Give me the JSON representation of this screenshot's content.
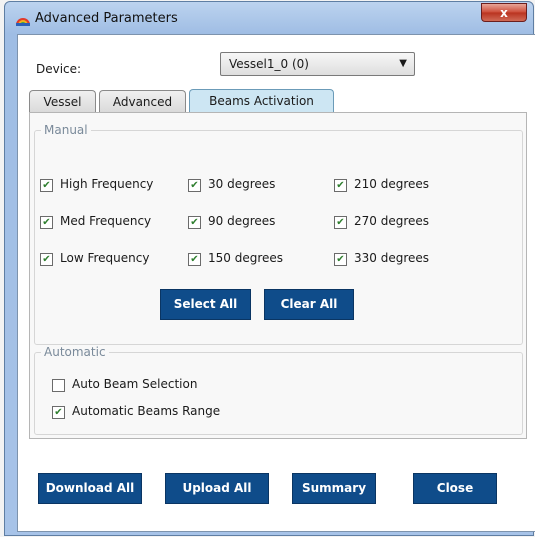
{
  "window": {
    "title": "Advanced Parameters",
    "close_glyph": "x"
  },
  "device": {
    "label": "Device:",
    "selected": "Vessel1_0 (0)"
  },
  "tabs": [
    {
      "label": "Vessel",
      "active": false
    },
    {
      "label": "Advanced",
      "active": false
    },
    {
      "label": "Beams Activation",
      "active": true
    }
  ],
  "manual": {
    "title": "Manual",
    "frequencies": [
      {
        "label": "High Frequency",
        "checked": true
      },
      {
        "label": "Med Frequency",
        "checked": true
      },
      {
        "label": "Low Frequency",
        "checked": true
      }
    ],
    "angles_a": [
      {
        "label": "30 degrees",
        "checked": true
      },
      {
        "label": "90 degrees",
        "checked": true
      },
      {
        "label": "150 degrees",
        "checked": true
      }
    ],
    "angles_b": [
      {
        "label": "210 degrees",
        "checked": true
      },
      {
        "label": "270 degrees",
        "checked": true
      },
      {
        "label": "330 degrees",
        "checked": true
      }
    ],
    "select_all": "Select All",
    "clear_all": "Clear All"
  },
  "automatic": {
    "title": "Automatic",
    "auto_beam": {
      "label": "Auto Beam Selection",
      "checked": false
    },
    "auto_range": {
      "label": "Automatic Beams Range",
      "checked": true
    }
  },
  "footer": {
    "download_all": "Download All",
    "upload_all": "Upload All",
    "summary": "Summary",
    "close": "Close"
  },
  "colors": {
    "button_bg": "#0f4c8a",
    "tab_active_bg": "#cde6f3",
    "check": "#2f7f2f"
  },
  "icons": {
    "app": "rainbow-dome-icon",
    "check": "checkmark-icon",
    "dropdown": "chevron-down-icon"
  }
}
